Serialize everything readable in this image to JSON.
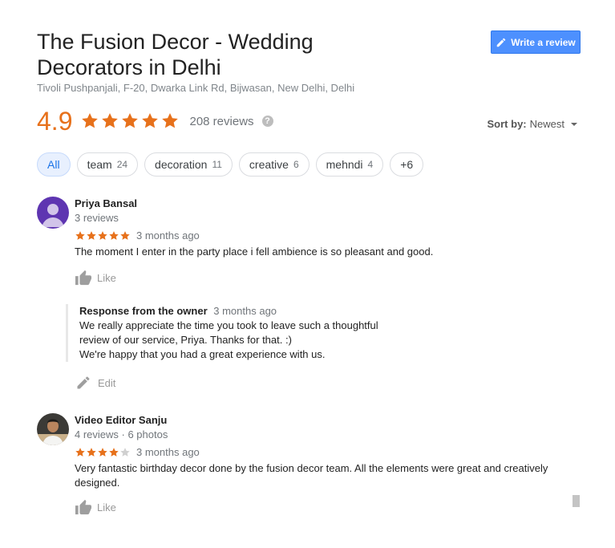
{
  "business": {
    "name": "The Fusion Decor - Wedding Decorators in Delhi",
    "address": "Tivoli Pushpanjali, F-20, Dwarka Link Rd, Bijwasan, New Delhi, Delhi"
  },
  "write_review": {
    "label": "Write a review",
    "icon": "pencil-icon"
  },
  "summary": {
    "rating": "4.9",
    "stars": 5,
    "review_count": "208 reviews",
    "help_icon": "?"
  },
  "sort": {
    "label": "Sort by:",
    "value": "Newest"
  },
  "filters": [
    {
      "label": "All",
      "count": "",
      "active": true
    },
    {
      "label": "team",
      "count": "24",
      "active": false
    },
    {
      "label": "decoration",
      "count": "11",
      "active": false
    },
    {
      "label": "creative",
      "count": "6",
      "active": false
    },
    {
      "label": "mehndi",
      "count": "4",
      "active": false
    },
    {
      "label": "+6",
      "count": "",
      "active": false
    }
  ],
  "reviews": [
    {
      "name": "Priya Bansal",
      "meta": "3 reviews",
      "stars": 5,
      "time": "3 months ago",
      "text": "The moment I enter in the party place i fell ambience is so pleasant and good.",
      "like_label": "Like",
      "owner_response": {
        "title": "Response from the owner",
        "time": "3 months ago",
        "lines": [
          "We really appreciate the time you took to leave such a thoughtful",
          "review of our service, Priya. Thanks for that. :)",
          "We're happy that you had a great experience with us."
        ],
        "edit_label": "Edit"
      }
    },
    {
      "name": "Video Editor Sanju",
      "meta": "4 reviews · 6 photos",
      "stars": 4,
      "time": "3 months ago",
      "text": "Very fantastic birthday decor done by the fusion decor team. All the elements were great and creatively designed.",
      "like_label": "Like"
    }
  ],
  "colors": {
    "star": "#e7711b",
    "star_empty": "#d0d0d0",
    "accent_blue": "#4d90fe",
    "avatar_purple": "#5e35b1"
  }
}
